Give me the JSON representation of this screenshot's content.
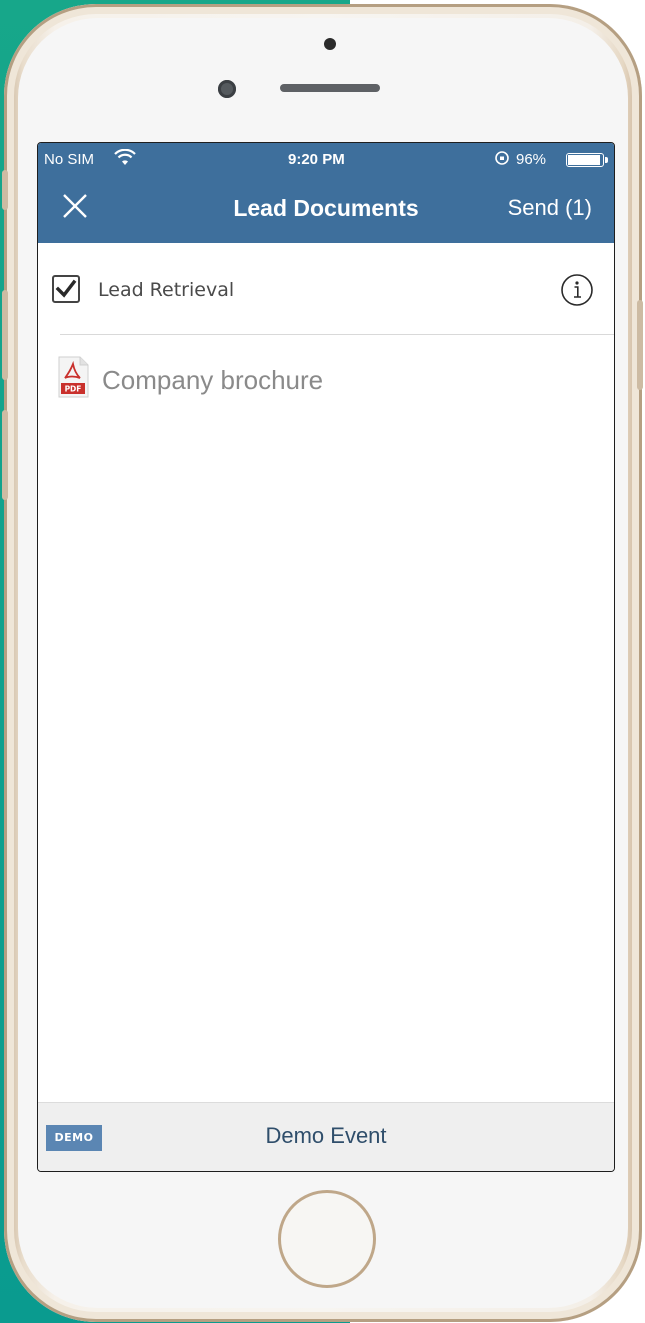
{
  "status_bar": {
    "carrier": "No SIM",
    "time": "9:20 PM",
    "battery": "96%",
    "battery_level": 0.96
  },
  "nav": {
    "close_icon": "close-icon",
    "title": "Lead Documents",
    "send_label": "Send (1)"
  },
  "items": [
    {
      "label": "Lead Retrieval",
      "checked": true,
      "icon": "info-icon"
    },
    {
      "label": "Company brochure",
      "icon": "pdf-icon"
    }
  ],
  "footer": {
    "badge": "DEMO",
    "event_name": "Demo Event"
  },
  "colors": {
    "nav_bar": "#3e6f9c",
    "badge": "#5b86b3",
    "teal_background": "#17a78a"
  }
}
